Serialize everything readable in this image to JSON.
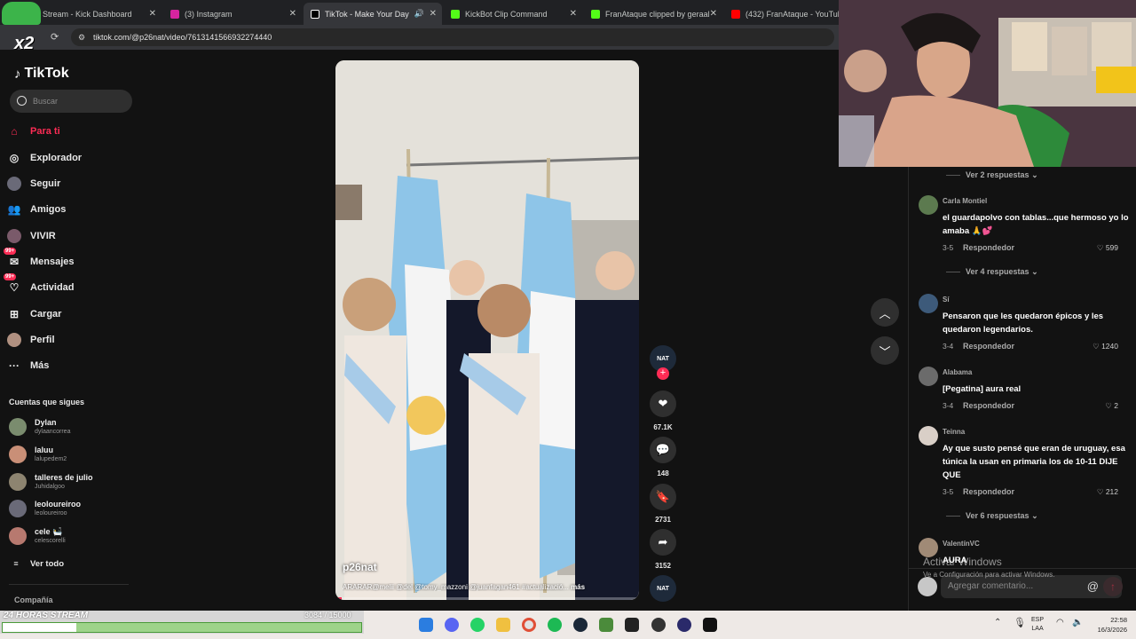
{
  "browser": {
    "tabs": [
      {
        "title": "Stream - Kick Dashboard",
        "color": "#53fc18"
      },
      {
        "title": "(3) Instagram",
        "color": "#d6249f"
      },
      {
        "title": "TikTok - Make Your Day",
        "color": "#ffffff"
      },
      {
        "title": "KickBot Clip Command",
        "color": "#53fc18"
      },
      {
        "title": "FranAtaque clipped by geraallit",
        "color": "#53fc18"
      },
      {
        "title": "(432) FranAtaque - YouTube",
        "color": "#ff0000"
      }
    ],
    "url": "tiktok.com/@p26nat/video/7613141566932274440"
  },
  "overlay": {
    "x2": "x2"
  },
  "sidebar": {
    "logo": "TikTok",
    "search_placeholder": "Buscar",
    "nav": [
      {
        "label": "Para ti",
        "icon": "home-icon"
      },
      {
        "label": "Explorador",
        "icon": "compass-icon"
      },
      {
        "label": "Seguir",
        "icon": "follow-icon"
      },
      {
        "label": "Amigos",
        "icon": "friends-icon"
      },
      {
        "label": "VIVIR",
        "icon": "live-icon"
      },
      {
        "label": "Mensajes",
        "icon": "message-icon",
        "badge": "99+"
      },
      {
        "label": "Actividad",
        "icon": "activity-icon",
        "badge": "99+"
      },
      {
        "label": "Cargar",
        "icon": "upload-icon"
      },
      {
        "label": "Perfil",
        "icon": "profile-icon"
      },
      {
        "label": "Más",
        "icon": "more-icon"
      }
    ],
    "following_title": "Cuentas que sigues",
    "following": [
      {
        "name": "Dylan",
        "handle": "dylaancorrea",
        "color": "#7a8c6e"
      },
      {
        "name": "laluu",
        "handle": "lalupedem2",
        "color": "#c98f77"
      },
      {
        "name": "talleres de julio",
        "handle": "Juhidalgoo",
        "color": "#8d8470"
      },
      {
        "name": "leoloureiroo",
        "handle": "leoloureiroo",
        "color": "#6a6a78"
      },
      {
        "name": "cele 🛀",
        "handle": "celescorelli",
        "color": "#b7796f"
      }
    ],
    "see_all": "Ver todo",
    "company": "Compañía"
  },
  "video": {
    "author": "p26nat",
    "caption": "ARARAR@melii @del @tomy_mazzoni @juanfagan461 #actualizació...",
    "more": "más",
    "progress": 0.02
  },
  "actions": {
    "avatar_label": "NAT",
    "likes": "67.1K",
    "comments": "148",
    "saves": "2731",
    "shares": "3152",
    "sound_label": "NAT"
  },
  "comments": {
    "view_replies": [
      "Ver 2 respuestas",
      "Ver 4 respuestas",
      "Ver 6 respuestas"
    ],
    "reply_label": "Respondedor",
    "list": [
      {
        "name": "Carla Montiel",
        "text": "el guardapolvo con tablas...que hermoso yo lo amaba 🙏💕",
        "date": "3-5",
        "likes": "599",
        "color": "#5c7a4f"
      },
      {
        "name": "Sí",
        "text": "Pensaron que les quedaron épicos y les quedaron legendarios.",
        "date": "3-4",
        "likes": "1240",
        "color": "#3d5a7a"
      },
      {
        "name": "Alabama",
        "text": "[Pegatina] aura real",
        "date": "3-4",
        "likes": "2",
        "color": "#6b6b6b"
      },
      {
        "name": "Teinna",
        "text": "Ay que susto pensé que eran de uruguay, esa túnica la usan en primaria los de 10-11 DIJE QUE",
        "date": "3-5",
        "likes": "212",
        "color": "#d9cfc7"
      },
      {
        "name": "ValentínVC",
        "text": "AURA",
        "color": "#a08a76"
      }
    ],
    "input_placeholder": "Agregar comentario..."
  },
  "windows": {
    "activate_title": "Activar Windows",
    "activate_sub": "Ve a Configuración para activar Windows."
  },
  "stream": {
    "label": "24 HORAS STREAM",
    "count": "3084 / 15000",
    "progress": 0.206
  },
  "taskbar": {
    "lang": "ESP",
    "lang2": "LAA",
    "time": "22:58",
    "date": "16/3/2026"
  }
}
